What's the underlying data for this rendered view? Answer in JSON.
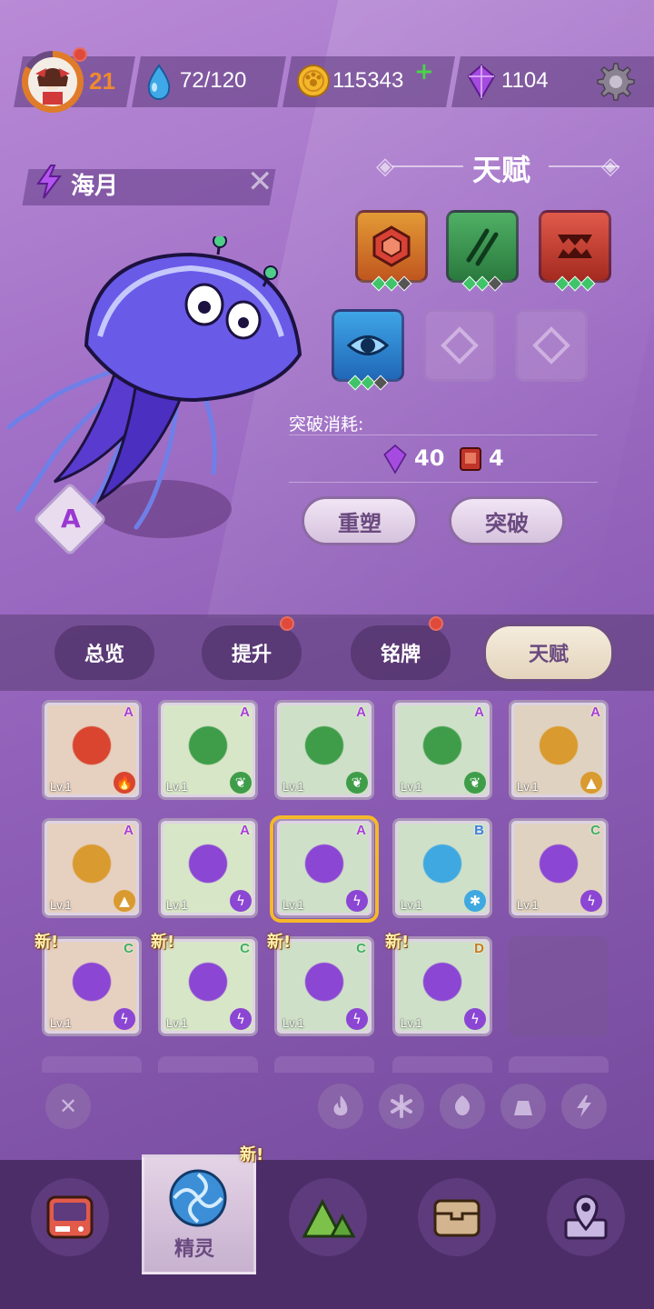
{
  "player": {
    "level": "21",
    "energy": "72/120",
    "coins": "115343",
    "gems": "1104"
  },
  "monster": {
    "name": "海月",
    "rank": "A"
  },
  "talent_panel": {
    "title": "天赋",
    "break_label": "突破消耗:",
    "cost_gems": "40",
    "cost_books": "4",
    "reshape_label": "重塑",
    "break_label_btn": "突破"
  },
  "tabs": [
    {
      "label": "总览",
      "badge": false
    },
    {
      "label": "提升",
      "badge": true
    },
    {
      "label": "铭牌",
      "badge": true
    },
    {
      "label": "天赋",
      "badge": false,
      "active": true
    }
  ],
  "monster_list": {
    "rows": [
      [
        {
          "lv": "Lv.1",
          "grade": "A",
          "type": "fire",
          "color": "#d9452f"
        },
        {
          "lv": "Lv.1",
          "grade": "A",
          "type": "leaf",
          "color": "#3f9d4a"
        },
        {
          "lv": "Lv.1",
          "grade": "A",
          "type": "leaf",
          "color": "#3f9d4a"
        },
        {
          "lv": "Lv.1",
          "grade": "A",
          "type": "leaf",
          "color": "#3f9d4a"
        },
        {
          "lv": "Lv.1",
          "grade": "A",
          "type": "rock",
          "color": "#d99a2f"
        }
      ],
      [
        {
          "lv": "Lv.1",
          "grade": "A",
          "type": "rock",
          "color": "#d99a2f"
        },
        {
          "lv": "Lv.1",
          "grade": "A",
          "type": "bolt",
          "color": "#8b46d4"
        },
        {
          "lv": "Lv.1",
          "grade": "A",
          "type": "bolt",
          "color": "#8b46d4"
        },
        {
          "lv": "Lv.1",
          "grade": "B",
          "type": "ice",
          "color": "#3fa8e0"
        },
        {
          "lv": "Lv.1",
          "grade": "C",
          "type": "bolt",
          "color": "#8b46d4"
        }
      ],
      [
        {
          "lv": "Lv.1",
          "grade": "C",
          "type": "bolt",
          "color": "#8b46d4",
          "new": "新!"
        },
        {
          "lv": "Lv.1",
          "grade": "C",
          "type": "bolt",
          "color": "#8b46d4",
          "new": "新!"
        },
        {
          "lv": "Lv.1",
          "grade": "C",
          "type": "bolt",
          "color": "#8b46d4",
          "new": "新!"
        },
        {
          "lv": "Lv.1",
          "grade": "D",
          "type": "bolt",
          "color": "#8b46d4",
          "new": "新!"
        }
      ]
    ]
  },
  "bottom_nav": {
    "active_label": "精灵",
    "new_tag": "新!"
  }
}
